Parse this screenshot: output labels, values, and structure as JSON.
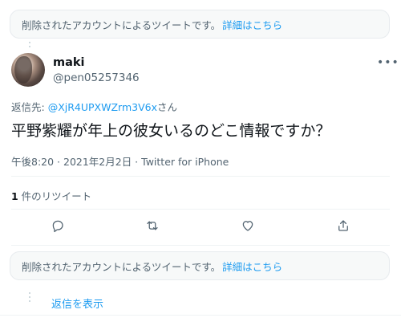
{
  "top_notice": {
    "text": "削除されたアカウントによるツイートです。",
    "link": "詳細はこちら"
  },
  "tweet": {
    "author_name": "maki",
    "author_handle": "@pen05257346",
    "more_menu": "•••",
    "reply_prefix": "返信先: ",
    "reply_user": "@XjR4UPXWZrm3V6x",
    "reply_suffix": "さん",
    "text": "平野紫耀が年上の彼女いるのどこ情報ですか？",
    "meta": "午後8:20 · 2021年2月2日 · Twitter for iPhone",
    "retweet_count": "1",
    "retweet_label": " 件のリツイート"
  },
  "actions": {
    "reply_icon": "reply-icon",
    "retweet_icon": "retweet-icon",
    "like_icon": "heart-icon",
    "share_icon": "share-icon"
  },
  "bottom_notice": {
    "text": "削除されたアカウントによるツイートです。",
    "link": "詳細はこちら"
  },
  "show_replies": "返信を表示",
  "colors": {
    "accent": "#1d9bf0",
    "muted": "#536471",
    "text": "#0f1419",
    "notice_bg": "#f7f9f9"
  }
}
